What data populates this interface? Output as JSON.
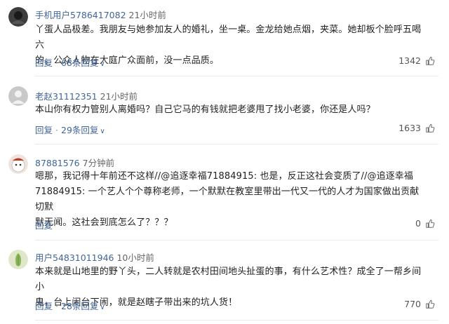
{
  "comments": [
    {
      "user": "手机用户5786417082",
      "time": "21小时前",
      "lines": [
        "丫蛋人品极差。我朋友与她参加友人的婚礼，坐一桌。金龙给她点烟，夹菜。她却板个脸呼五喝六",
        "的。公众人物在大庭广众面前，没一点品质。"
      ],
      "reply_label": "回复",
      "replies_label": "68条回复",
      "likes": "1342"
    },
    {
      "user": "老赵31112351",
      "time": "21小时前",
      "lines": [
        "本山你有权力管别人离婚吗？自己它马的有钱就把老婆甩了找小老婆，你还是人吗？"
      ],
      "reply_label": "回复",
      "replies_label": "29条回复",
      "likes": "1633"
    },
    {
      "user": "87881576",
      "time": "7分钟前",
      "lines": [
        "嗯那，我记得十年前还不这样//@追逐幸福71884915: 也是，反正这社会变质了//@追逐幸福",
        "71884915: 一个艺人个个尊称老师，一个默默在教室里带出一代又一代的人才为国家做出贡献切默",
        "默无闻。这社会到底怎么了？？？"
      ],
      "reply_label": "回复",
      "replies_label": "",
      "likes": "0"
    },
    {
      "user": "用户54831011946",
      "time": "10小时前",
      "lines": [
        "本来就是山地里的野丫头，二人转就是农村田间地头扯蛋的事，有什么艺术性？成全了一帮乡间小",
        "鬼，台上闹台下闹，就是赵瞎子带出来的坑人货！"
      ],
      "reply_label": "回复",
      "replies_label": "28条回复",
      "likes": "770"
    }
  ]
}
